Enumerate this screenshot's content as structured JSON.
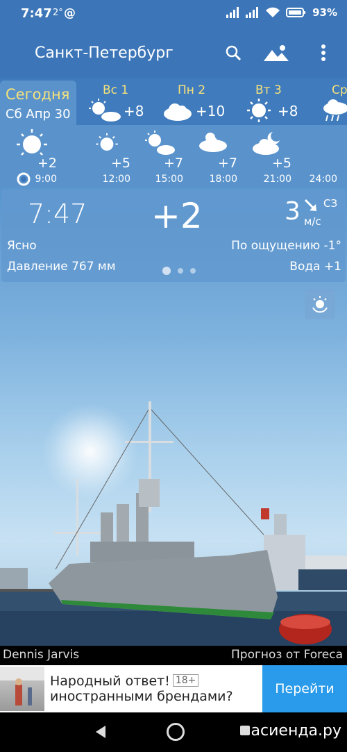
{
  "status_bar": {
    "time": "7:47",
    "note": "2°",
    "at_icon": "@",
    "battery": "93%"
  },
  "app_bar": {
    "city": "Санкт-Петербург",
    "icons": [
      "search-icon",
      "landscape-icon",
      "more-icon"
    ]
  },
  "days": {
    "today": {
      "label": "Сегодня",
      "date": "Сб Апр 30"
    },
    "items": [
      {
        "name": "Вс 1",
        "temp": "+8",
        "icon": "sun-cloud-icon"
      },
      {
        "name": "Пн 2",
        "temp": "+10",
        "icon": "cloud-icon"
      },
      {
        "name": "Вт 3",
        "temp": "+8",
        "icon": "sun-icon"
      },
      {
        "name": "Ср",
        "temp": "",
        "icon": "rain-cloud-icon"
      }
    ]
  },
  "hourly": [
    {
      "time": "9:00",
      "temp": "+2",
      "icon": "sun-icon"
    },
    {
      "time": "12:00",
      "temp": "+5",
      "icon": "sun-icon"
    },
    {
      "time": "15:00",
      "temp": "+7",
      "icon": "sun-cloud-icon"
    },
    {
      "time": "18:00",
      "temp": "+7",
      "icon": "sun-cloud-icon"
    },
    {
      "time": "21:00",
      "temp": "+5",
      "icon": "cloud-icon"
    },
    {
      "time": "24:00",
      "temp": "",
      "icon": "moon-cloud-icon"
    }
  ],
  "current": {
    "time": "7:47",
    "temp": "+2",
    "wind_speed": "3",
    "wind_dir": "СЗ",
    "wind_unit": "м/с",
    "condition": "Ясно",
    "feels_like": "По ощущению -1°",
    "pressure": "Давление 767 мм",
    "water": "Вода +1",
    "page_dots": 3,
    "active_dot": 0
  },
  "photo": {
    "author": "Dennis Jarvis",
    "provider": "Прогноз от Foreca"
  },
  "ad": {
    "title": "Народный ответ!",
    "age": "18+",
    "subtitle": "иностранными брендами?",
    "button": "Перейти"
  },
  "watermark": "асиенда.ру",
  "colors": {
    "bar": "#3c76b8",
    "accent": "#f6e27a",
    "ad_button": "#2a9bea"
  }
}
